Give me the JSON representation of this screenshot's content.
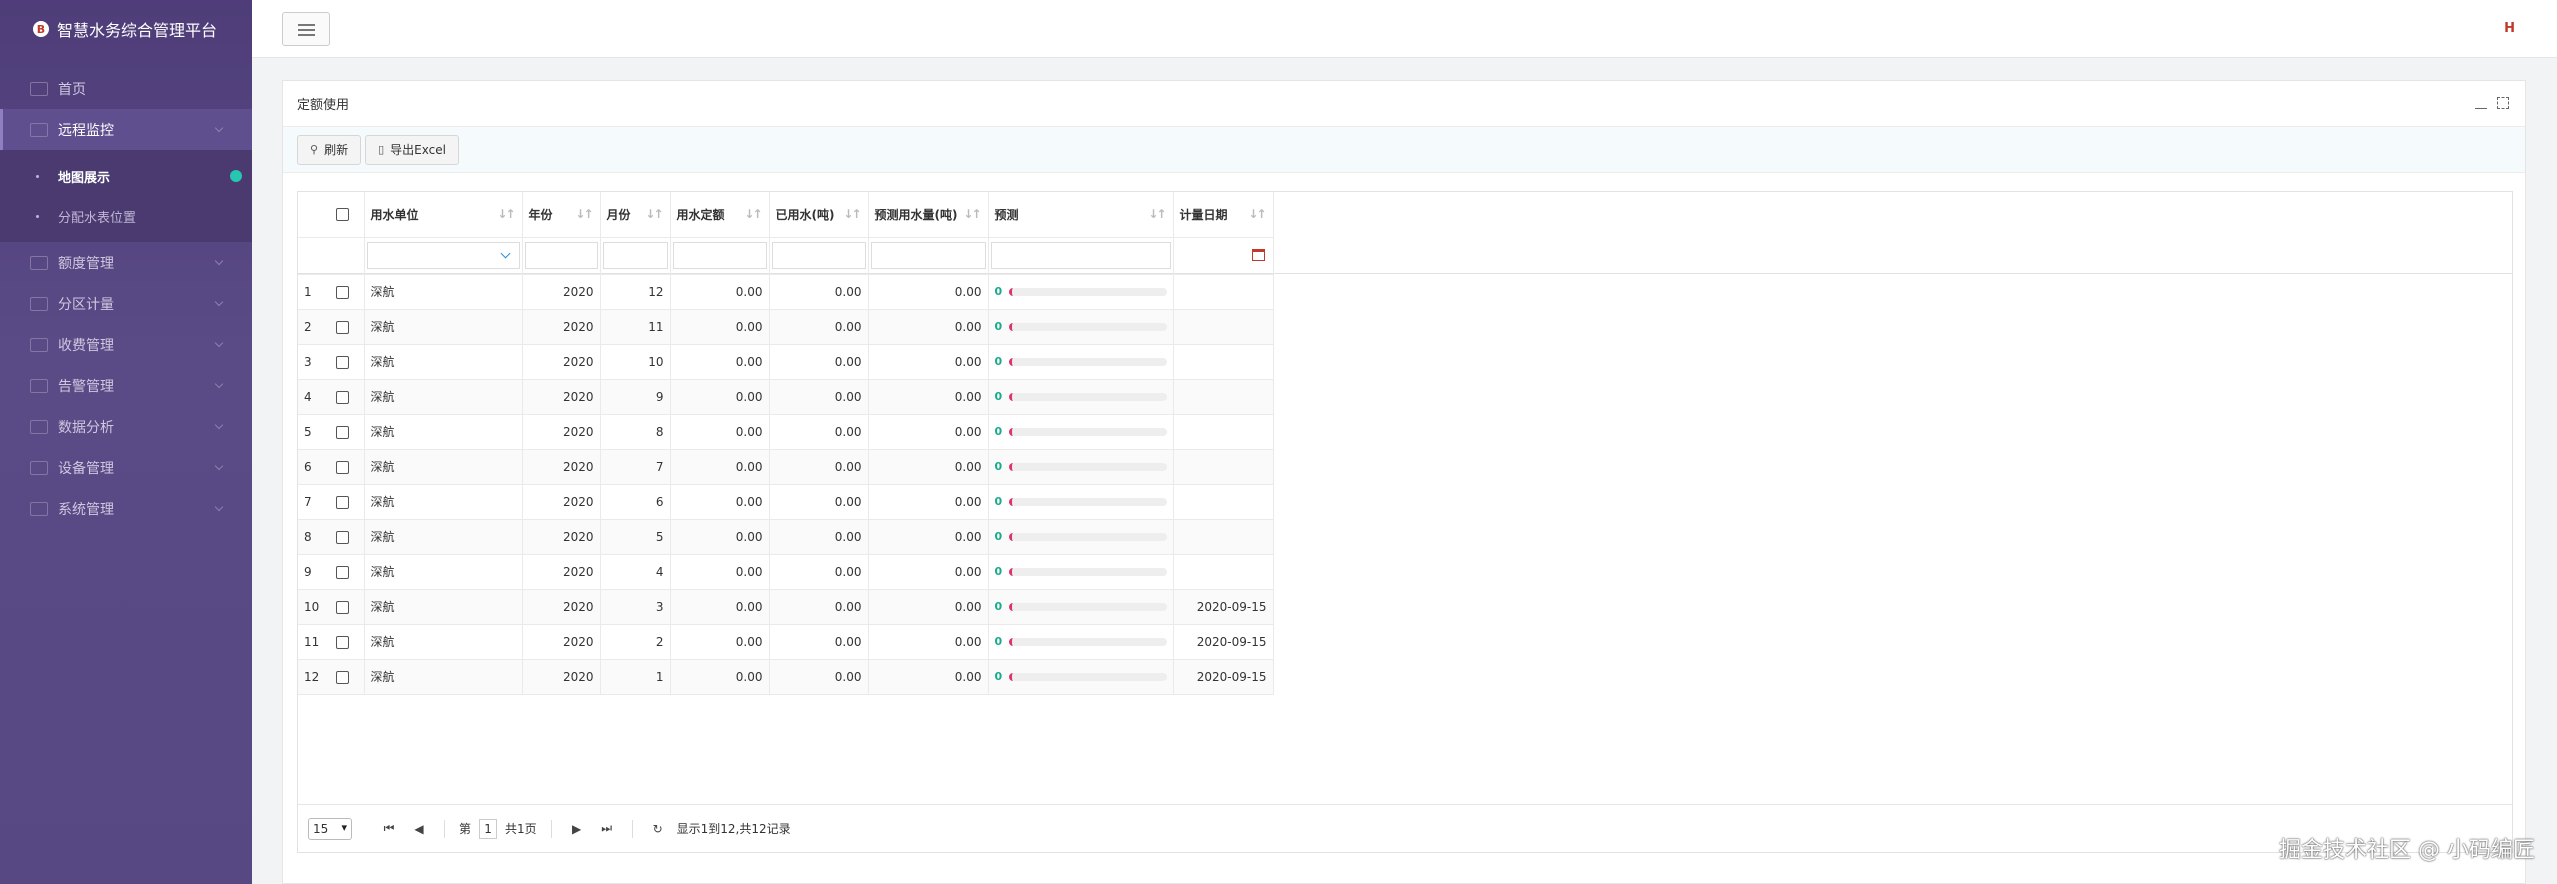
{
  "brand": {
    "logo_text": "B",
    "title": "智慧水务综合管理平台"
  },
  "sidebar": {
    "items": [
      {
        "label": "首页",
        "icon": "home-icon"
      },
      {
        "label": "远程监控",
        "icon": "monitor-icon",
        "open": true
      },
      {
        "label": "额度管理",
        "icon": "quota-icon"
      },
      {
        "label": "分区计量",
        "icon": "grid-icon"
      },
      {
        "label": "收费管理",
        "icon": "fee-icon"
      },
      {
        "label": "告警管理",
        "icon": "alarm-icon"
      },
      {
        "label": "数据分析",
        "icon": "chart-icon"
      },
      {
        "label": "设备管理",
        "icon": "device-icon"
      },
      {
        "label": "系统管理",
        "icon": "settings-icon"
      }
    ],
    "subitems": [
      {
        "label": "地图展示",
        "active": true
      },
      {
        "label": "分配水表位置"
      }
    ]
  },
  "topbar": {
    "user_icon_text": "H"
  },
  "panel": {
    "title": "定额使用",
    "refresh_label": "刷新",
    "export_label": "导出Excel"
  },
  "grid": {
    "columns": [
      "用水单位",
      "年份",
      "月份",
      "用水定额",
      "已用水(吨)",
      "预测用水量(吨)",
      "预测",
      "计量日期"
    ],
    "rows": [
      {
        "idx": "1",
        "unit": "深航",
        "year": "2020",
        "month": "12",
        "quota": "0.00",
        "used": "0.00",
        "forecast": "0.00",
        "pred": "0",
        "date": ""
      },
      {
        "idx": "2",
        "unit": "深航",
        "year": "2020",
        "month": "11",
        "quota": "0.00",
        "used": "0.00",
        "forecast": "0.00",
        "pred": "0",
        "date": ""
      },
      {
        "idx": "3",
        "unit": "深航",
        "year": "2020",
        "month": "10",
        "quota": "0.00",
        "used": "0.00",
        "forecast": "0.00",
        "pred": "0",
        "date": ""
      },
      {
        "idx": "4",
        "unit": "深航",
        "year": "2020",
        "month": "9",
        "quota": "0.00",
        "used": "0.00",
        "forecast": "0.00",
        "pred": "0",
        "date": ""
      },
      {
        "idx": "5",
        "unit": "深航",
        "year": "2020",
        "month": "8",
        "quota": "0.00",
        "used": "0.00",
        "forecast": "0.00",
        "pred": "0",
        "date": ""
      },
      {
        "idx": "6",
        "unit": "深航",
        "year": "2020",
        "month": "7",
        "quota": "0.00",
        "used": "0.00",
        "forecast": "0.00",
        "pred": "0",
        "date": ""
      },
      {
        "idx": "7",
        "unit": "深航",
        "year": "2020",
        "month": "6",
        "quota": "0.00",
        "used": "0.00",
        "forecast": "0.00",
        "pred": "0",
        "date": ""
      },
      {
        "idx": "8",
        "unit": "深航",
        "year": "2020",
        "month": "5",
        "quota": "0.00",
        "used": "0.00",
        "forecast": "0.00",
        "pred": "0",
        "date": ""
      },
      {
        "idx": "9",
        "unit": "深航",
        "year": "2020",
        "month": "4",
        "quota": "0.00",
        "used": "0.00",
        "forecast": "0.00",
        "pred": "0",
        "date": ""
      },
      {
        "idx": "10",
        "unit": "深航",
        "year": "2020",
        "month": "3",
        "quota": "0.00",
        "used": "0.00",
        "forecast": "0.00",
        "pred": "0",
        "date": "2020-09-15"
      },
      {
        "idx": "11",
        "unit": "深航",
        "year": "2020",
        "month": "2",
        "quota": "0.00",
        "used": "0.00",
        "forecast": "0.00",
        "pred": "0",
        "date": "2020-09-15"
      },
      {
        "idx": "12",
        "unit": "深航",
        "year": "2020",
        "month": "1",
        "quota": "0.00",
        "used": "0.00",
        "forecast": "0.00",
        "pred": "0",
        "date": "2020-09-15"
      }
    ]
  },
  "pager": {
    "page_size": "15",
    "page_prefix": "第",
    "page_value": "1",
    "page_total": "共1页",
    "summary": "显示1到12,共12记录"
  },
  "watermark": "掘金技术社区 @ 小码编匠",
  "colors": {
    "sidebar": "#574783",
    "accent_teal": "#26c6b0",
    "progress_pink": "#e0316a"
  }
}
